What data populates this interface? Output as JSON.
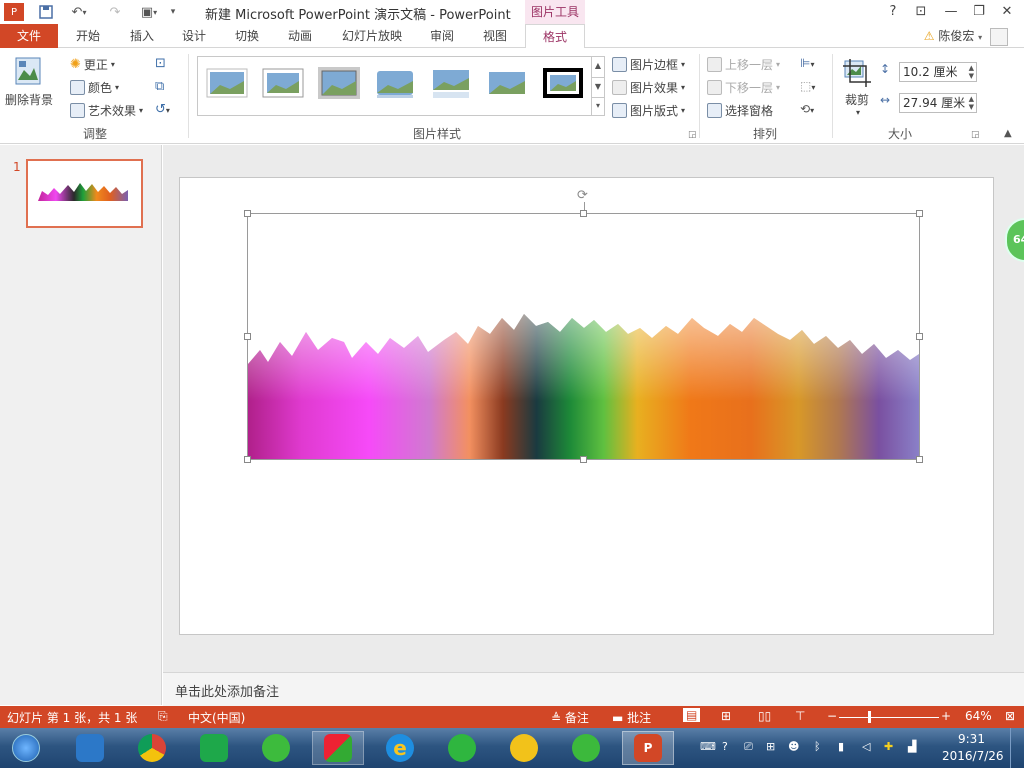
{
  "titlebar": {
    "app_title": "新建 Microsoft PowerPoint 演示文稿 - PowerPoint",
    "tool_context": "图片工具",
    "help": "?",
    "restore_ribbon": "⊡",
    "minimize": "—",
    "maximize": "❐",
    "close": "✕"
  },
  "tabs": {
    "file": "文件",
    "items": [
      "开始",
      "插入",
      "设计",
      "切换",
      "动画",
      "幻灯片放映",
      "审阅",
      "视图"
    ],
    "format": "格式",
    "user": "陈俊宏"
  },
  "ribbon": {
    "adjust": {
      "remove_bg": "删除背景",
      "corrections": "更正",
      "color": "颜色",
      "artistic": "艺术效果",
      "label": "调整"
    },
    "styles": {
      "border": "图片边框",
      "effects": "图片效果",
      "layout": "图片版式",
      "label": "图片样式"
    },
    "arrange": {
      "bring_forward": "上移一层",
      "send_backward": "下移一层",
      "selection_pane": "选择窗格",
      "label": "排列"
    },
    "size": {
      "crop": "裁剪",
      "height": "10.2 厘米",
      "width": "27.94 厘米",
      "label": "大小"
    }
  },
  "slides_pane": {
    "slide_number": "1"
  },
  "editor": {
    "zoom_bubble": "64"
  },
  "notes": {
    "placeholder": "单击此处添加备注"
  },
  "status": {
    "slide_info": "幻灯片 第 1 张，共 1 张",
    "language": "中文(中国)",
    "notes": "备注",
    "comments": "批注",
    "zoom": "64%",
    "zoom_level": 0.64
  },
  "taskbar": {
    "time": "9:31",
    "date": "2016/7/26"
  },
  "colors": {
    "accent": "#d24726",
    "format_tab": "#9c3465",
    "taskbar": "#2d5581"
  }
}
